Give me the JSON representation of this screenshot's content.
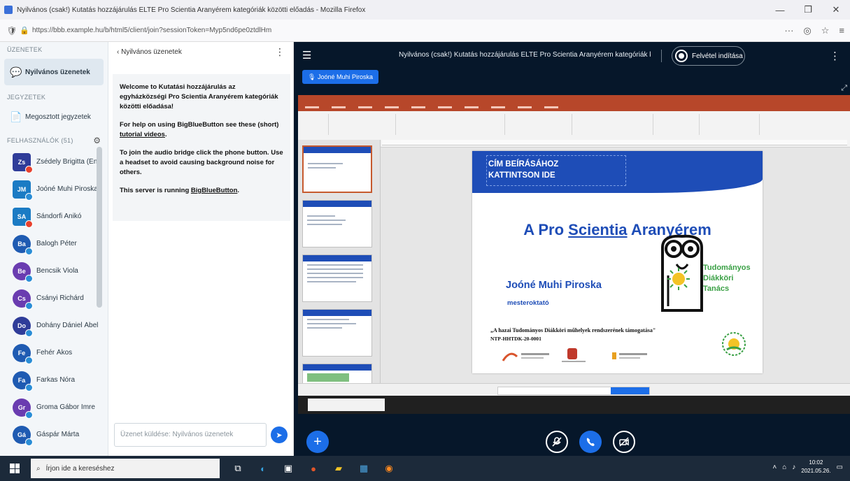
{
  "browser": {
    "window_title": "Nyilvános (csak!) Kutatás hozzájárulás ELTE Pro Scientia Aranyérem kategóriák közötti előadás - Mozilla Firefox",
    "url": "https://bbb.example.hu/b/html5/client/join?sessionToken=Myp5nd6pe0ztdlHm",
    "win_minimize": "—",
    "win_maximize": "❐",
    "win_close": "✕"
  },
  "sidebar": {
    "messages_label": "Üzenetek",
    "public_chat_label": "Nyilvános üzenetek",
    "notes_label": "Jegyzetek",
    "shared_notes_label": "Megosztott jegyzetek",
    "users_label": "Felhasználók (51)",
    "users": [
      {
        "initials": "Zs",
        "name": "Zsédely Brigitta (Én)",
        "color": "#2f3c99",
        "badge": "#e8412e",
        "square": true
      },
      {
        "initials": "JM",
        "name": "Joóné Muhi Piroska",
        "color": "#1b7bc4",
        "badge": "#2a8dd6",
        "square": true
      },
      {
        "initials": "SA",
        "name": "Sándorfi Anikó",
        "color": "#1b7bc4",
        "badge": "#e8412e",
        "square": true
      },
      {
        "initials": "Ba",
        "name": "Balogh Péter",
        "color": "#1f5bb2",
        "badge": "#2a8dd6",
        "square": false
      },
      {
        "initials": "Be",
        "name": "Bencsik Viola",
        "color": "#6a3cb0",
        "badge": "#2a8dd6",
        "square": false
      },
      {
        "initials": "Cs",
        "name": "Csányi Richárd",
        "color": "#6a3cb0",
        "badge": "#2a8dd6",
        "square": false
      },
      {
        "initials": "Do",
        "name": "Dohány Dániel Ábel",
        "color": "#2f3c99",
        "badge": "#2a8dd6",
        "square": false
      },
      {
        "initials": "Fe",
        "name": "Fehér Ákos",
        "color": "#1f5bb2",
        "badge": "#2a8dd6",
        "square": false
      },
      {
        "initials": "Fa",
        "name": "Farkas Nóra",
        "color": "#1f5bb2",
        "badge": "#2a8dd6",
        "square": false
      },
      {
        "initials": "Gr",
        "name": "Groma Gábor Imre",
        "color": "#6a3cb0",
        "badge": "#2a8dd6",
        "square": false
      },
      {
        "initials": "Gá",
        "name": "Gáspár Márta",
        "color": "#1f5bb2",
        "badge": "#2a8dd6",
        "square": false
      }
    ]
  },
  "chat": {
    "header": "Nyilvános üzenetek",
    "welcome_1": "Welcome to Kutatási hozzájárulás az egyházközségi Pro Scientia Aranyérem kategóriák közötti előadása!",
    "welcome_2a": "For help on using BigBlueButton see these (short) ",
    "welcome_2_link": "tutorial videos",
    "welcome_2b": ".",
    "welcome_3": "To join the audio bridge click the phone button. Use a headset to avoid causing background noise for others.",
    "welcome_4a": "This server is running ",
    "welcome_4_link": "BigBlueButton",
    "welcome_4b": ".",
    "input_placeholder": "Üzenet küldése: Nyilvános üzenetek"
  },
  "stage": {
    "meeting_title": "Nyilvános (csak!) Kutatás hozzájárulás ELTE Pro Scientia Aranyérem kategóriák közötti...",
    "record_label": "Felvétel indítása",
    "talker": "Joóné Muhi Piroska"
  },
  "slide": {
    "placeholder_1": "CÍM BEÍRÁSÁHOZ",
    "placeholder_2": "KATTINTSON IDE",
    "title_pre": "A Pro ",
    "title_u": "Scientia",
    "title_post": " Aranyérem",
    "author": "Joóné Muhi Piroska",
    "role": "mesteroktató",
    "tdk_1": "Tudományos",
    "tdk_2": "Diákköri",
    "tdk_3": "Tanács",
    "quote": "„A hazai Tudományos Diákköri műhelyek rendszerének támogatása\"",
    "quote_sub": "NTP-HHTDK-20-0001"
  },
  "taskbar": {
    "search_placeholder": "Írjon ide a kereséshez",
    "time": "10:02",
    "date": "2021.05.26."
  },
  "icons": {
    "chat": "💬",
    "notes": "📄",
    "gear": "⚙",
    "kebab": "⋮",
    "plus": "+",
    "send": "➤",
    "mic": "🎙",
    "phone": "📞",
    "camera": "🎥"
  }
}
